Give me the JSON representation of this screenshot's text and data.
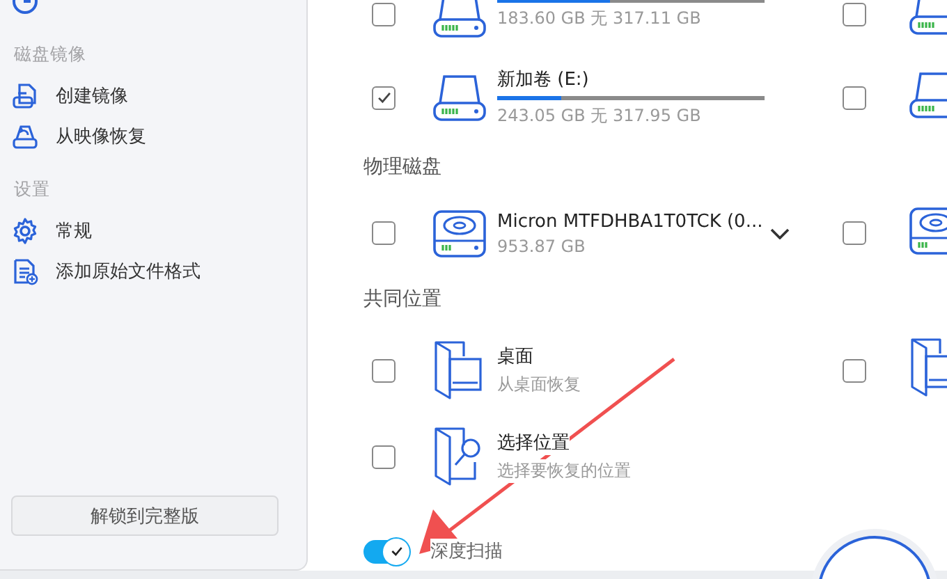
{
  "sidebar": {
    "sections": [
      {
        "items": [
          {
            "kind": "clock"
          }
        ]
      },
      {
        "title": "磁盘镜像",
        "items": [
          {
            "kind": "image-create",
            "label": "创建镜像"
          },
          {
            "kind": "image-restore",
            "label": "从映像恢复"
          }
        ]
      },
      {
        "title": "设置",
        "items": [
          {
            "kind": "gear",
            "label": "常规"
          },
          {
            "kind": "file-add",
            "label": "添加原始文件格式"
          }
        ]
      }
    ],
    "upgrade_button": "解锁到完整版"
  },
  "main": {
    "sections": [
      {
        "rows": [
          {
            "kind": "volume",
            "level": 0.42,
            "capacity": "183.60 GB 无 317.11 GB",
            "checked": false,
            "right_checked": false
          },
          {
            "kind": "volume",
            "name": "新加卷 (E:)",
            "level": 0.24,
            "capacity": "243.05 GB 无 317.95 GB",
            "checked": true,
            "right_checked": false
          }
        ]
      },
      {
        "title": "物理磁盘",
        "rows": [
          {
            "kind": "disk",
            "name": "Micron MTFDHBA1T0TCK (0...",
            "capacity": "953.87 GB",
            "checked": false,
            "right_checked": false
          }
        ]
      },
      {
        "title": "共同位置",
        "rows": [
          {
            "kind": "desktop",
            "name": "桌面",
            "description": "从桌面恢复",
            "checked": false,
            "right_checked": false
          },
          {
            "kind": "folder-search",
            "name": "选择位置",
            "description": "选择要恢复的位置",
            "checked": false
          }
        ]
      }
    ],
    "deep_scan": {
      "label": "深度扫描",
      "on": true
    }
  }
}
